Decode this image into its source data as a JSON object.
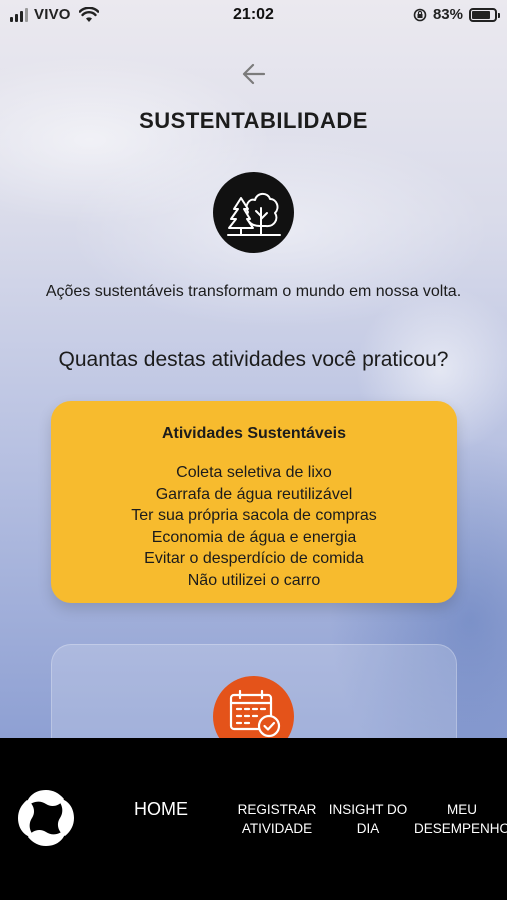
{
  "status_bar": {
    "carrier": "VIVO",
    "time": "21:02",
    "battery_percent": "83%",
    "battery_level": 0.83
  },
  "header": {
    "back_icon": "arrow-left-icon",
    "title": "SUSTENTABILIDADE"
  },
  "hero": {
    "icon": "trees-icon",
    "subtitle": "Ações sustentáveis transformam o mundo em nossa volta."
  },
  "question": "Quantas destas atividades você praticou?",
  "activities_card": {
    "title": "Atividades Sustentáveis",
    "items": [
      "Coleta seletiva de lixo",
      "Garrafa de água reutilizável",
      "Ter sua própria sacola de compras",
      "Economia de água e energia",
      "Evitar o desperdício de comida",
      "Não utilizei o carro"
    ]
  },
  "second_card": {
    "icon": "calendar-check-icon"
  },
  "bottom_nav": {
    "logo": "app-logo-icon",
    "home": "HOME",
    "registrar_line1": "REGISTRAR",
    "registrar_line2": "ATIVIDADE",
    "insight_line1": "INSIGHT DO",
    "insight_line2": "DIA",
    "desempenho_line1": "MEU",
    "desempenho_line2": "DESEMPENHO"
  },
  "colors": {
    "card_yellow": "#f7bb2e",
    "calendar_orange": "#e4531a",
    "nav_background": "#000000"
  }
}
